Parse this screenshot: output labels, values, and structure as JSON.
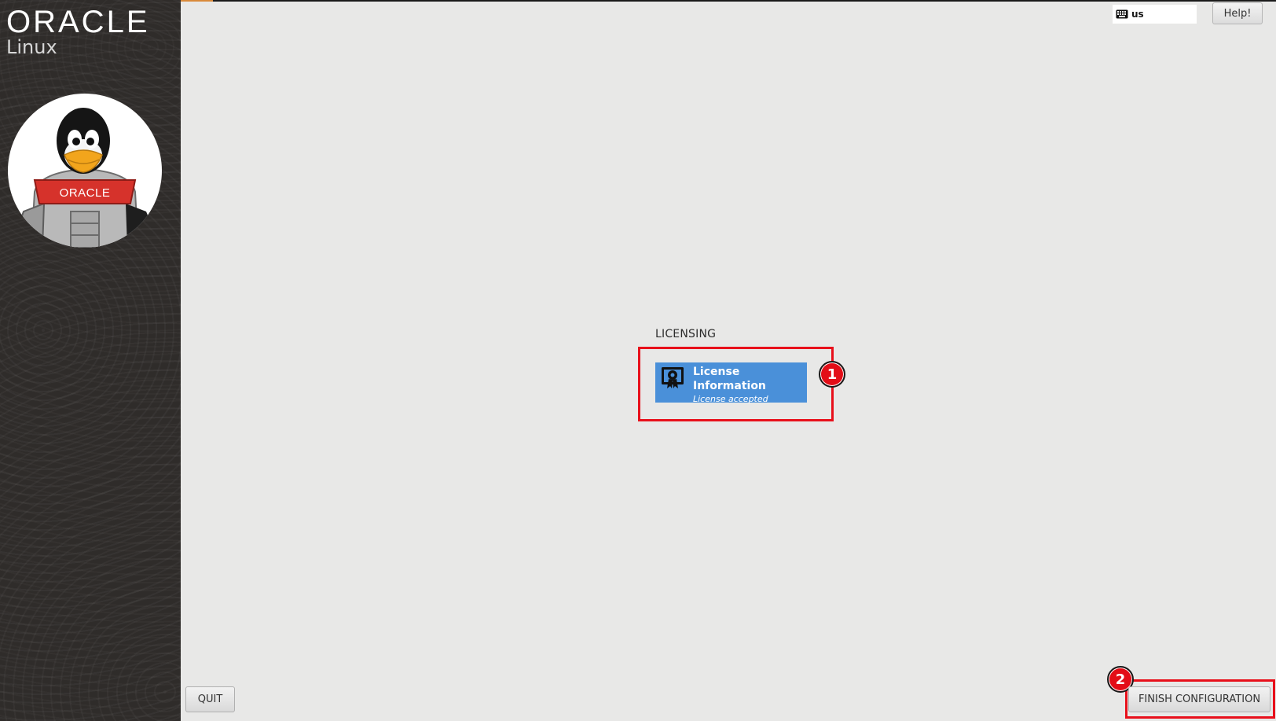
{
  "window": {
    "accent_color": "#d98a3a"
  },
  "sidebar": {
    "brand": "ORACLE",
    "brand_sub": "Linux",
    "mascot_badge": "ORACLE"
  },
  "header": {
    "keyboard_layout": "us",
    "help_label": "Help!"
  },
  "main": {
    "section_title": "LICENSING",
    "spoke": {
      "title": "License Information",
      "status": "License accepted",
      "color": "#4a90d9",
      "icon": "license-certificate-icon"
    }
  },
  "footer": {
    "quit_label": "QUIT",
    "finish_label": "FINISH CONFIGURATION"
  },
  "annotations": {
    "color": "#e8101b",
    "badge_1": "1",
    "badge_2": "2"
  }
}
